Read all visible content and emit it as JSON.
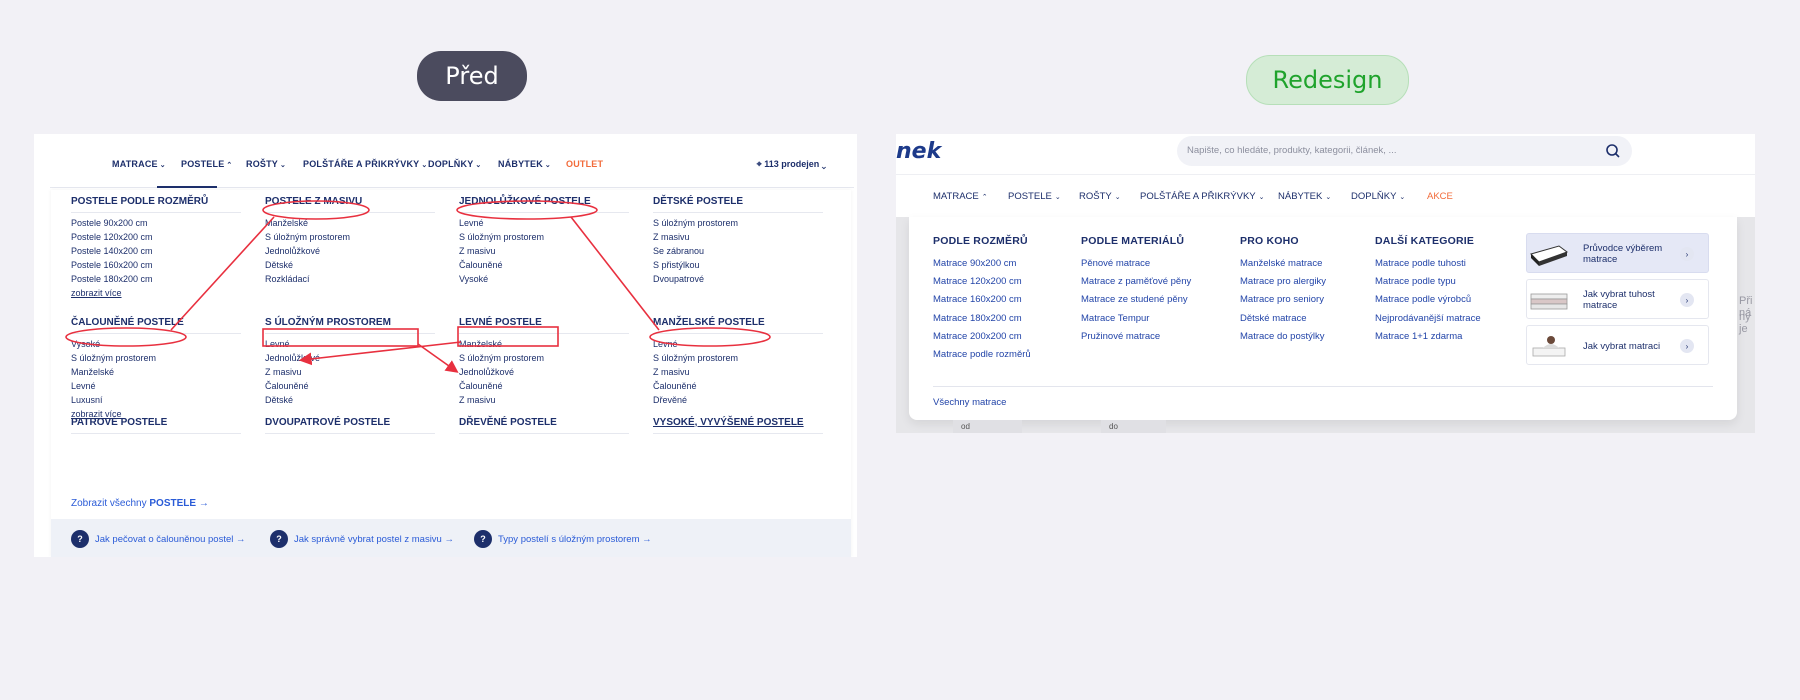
{
  "labels": {
    "before": "Před",
    "after": "Redesign"
  },
  "before": {
    "nav": [
      {
        "label": "MATRACE",
        "chev": "⌄"
      },
      {
        "label": "POSTELE",
        "chev": "⌃"
      },
      {
        "label": "ROŠTY",
        "chev": "⌄"
      },
      {
        "label": "POLŠTÁŘE A PŘIKRÝVKY",
        "chev": "⌄"
      },
      {
        "label": "DOPLŇKY",
        "chev": "⌄"
      },
      {
        "label": "NÁBYTEK",
        "chev": "⌄"
      },
      {
        "label": "OUTLET",
        "chev": ""
      }
    ],
    "stores": "113 prodejen",
    "sections": [
      {
        "title": "POSTELE PODLE ROZMĚRŮ",
        "links": [
          "Postele 90x200 cm",
          "Postele 120x200 cm",
          "Postele 140x200 cm",
          "Postele 160x200 cm",
          "Postele 180x200 cm"
        ],
        "more": "zobrazit více"
      },
      {
        "title": "POSTELE Z MASIVU",
        "links": [
          "Manželské",
          "S úložným prostorem",
          "Jednolůžkové",
          "Dětské",
          "Rozkládací"
        ],
        "more": ""
      },
      {
        "title": "JEDNOLŮŽKOVÉ POSTELE",
        "links": [
          "Levné",
          "S úložným prostorem",
          "Z masivu",
          "Čalouněné",
          "Vysoké"
        ],
        "more": ""
      },
      {
        "title": "DĚTSKÉ POSTELE",
        "links": [
          "S úložným prostorem",
          "Z masivu",
          "Se zábranou",
          "S přistýlkou",
          "Dvoupatrové"
        ],
        "more": ""
      },
      {
        "title": "ČALOUNĚNÉ POSTELE",
        "links": [
          "Vysoké",
          "S úložným prostorem",
          "Manželské",
          "Levné",
          "Luxusní"
        ],
        "more": "zobrazit více"
      },
      {
        "title": "S ÚLOŽNÝM PROSTOREM",
        "links": [
          "Levné",
          "Jednolůžkové",
          "Z masivu",
          "Čalouněné",
          "Dětské"
        ],
        "more": ""
      },
      {
        "title": "LEVNÉ POSTELE",
        "links": [
          "Manželské",
          "S úložným prostorem",
          "Jednolůžkové",
          "Čalouněné",
          "Z masivu"
        ],
        "more": ""
      },
      {
        "title": "MANŽELSKÉ POSTELE",
        "links": [
          "Levné",
          "S úložným prostorem",
          "Z masivu",
          "Čalouněné",
          "Dřevěné"
        ],
        "more": ""
      },
      {
        "title": "PATROVÉ POSTELE",
        "links": [],
        "more": ""
      },
      {
        "title": "DVOUPATROVÉ POSTELE",
        "links": [],
        "more": ""
      },
      {
        "title": "DŘEVĚNÉ POSTELE",
        "links": [],
        "more": ""
      },
      {
        "title": "VYSOKÉ, VYVÝŠENÉ POSTELE",
        "links": [],
        "more": ""
      }
    ],
    "show_all_prefix": "Zobrazit všechny",
    "show_all_bold": "POSTELE",
    "arrow": "→",
    "footer": [
      {
        "icon": "?",
        "label": "Jak pečovat o čalouněnou postel"
      },
      {
        "icon": "?",
        "label": "Jak správně vybrat postel z masivu"
      },
      {
        "icon": "?",
        "label": "Typy postelí s úložným prostorem"
      }
    ],
    "annotation_color": "#e8303f"
  },
  "after": {
    "logo": "nek",
    "search_placeholder": "Napište, co hledáte, produkty, kategorii, článek, ...",
    "nav": [
      {
        "label": "MATRACE",
        "chev": "⌃"
      },
      {
        "label": "POSTELE",
        "chev": "⌄"
      },
      {
        "label": "ROŠTY",
        "chev": "⌄"
      },
      {
        "label": "POLŠTÁŘE A PŘIKRÝVKY",
        "chev": "⌄"
      },
      {
        "label": "NÁBYTEK",
        "chev": "⌄"
      },
      {
        "label": "DOPLŇKY",
        "chev": "⌄"
      },
      {
        "label": "AKCE",
        "chev": ""
      }
    ],
    "columns": [
      {
        "title": "PODLE ROZMĚRŮ",
        "links": [
          "Matrace 90x200 cm",
          "Matrace 120x200 cm",
          "Matrace 160x200 cm",
          "Matrace 180x200 cm",
          "Matrace 200x200 cm",
          "Matrace podle rozměrů"
        ]
      },
      {
        "title": "PODLE MATERIÁLŮ",
        "links": [
          "Pěnové matrace",
          "Matrace z paměťové pěny",
          "Matrace ze studené pěny",
          "Matrace Tempur",
          "Pružinové matrace"
        ]
      },
      {
        "title": "PRO KOHO",
        "links": [
          "Manželské matrace",
          "Matrace pro alergiky",
          "Matrace pro seniory",
          "Dětské matrace",
          "Matrace do postýlky"
        ]
      },
      {
        "title": "DALŠÍ KATEGORIE",
        "links": [
          "Matrace podle tuhosti",
          "Matrace podle typu",
          "Matrace podle výrobců",
          "Nejprodávanější matrace",
          "Matrace 1+1 zdarma"
        ]
      }
    ],
    "guides": [
      {
        "label": "Průvodce výběrem matrace",
        "icon": "mattress-icon"
      },
      {
        "label": "Jak vybrat tuhost matrace",
        "icon": "mattress-layers-icon"
      },
      {
        "label": "Jak vybrat matraci",
        "icon": "person-on-mattress-icon"
      }
    ],
    "guide_arrow": "›",
    "all_link": "Všechny matrace",
    "behind_text": [
      "Při ná",
      "ný je"
    ],
    "under_tabs": [
      "od",
      "do"
    ]
  }
}
